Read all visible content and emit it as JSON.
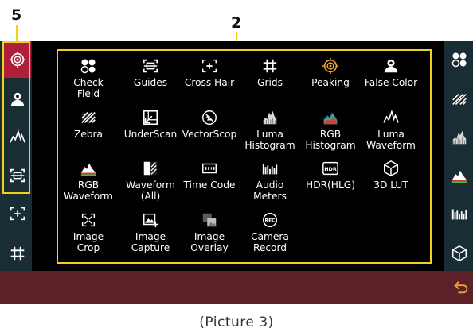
{
  "callouts": {
    "left": "5",
    "menu": "2"
  },
  "caption": "(Picture 3)",
  "colors": {
    "accent": "#f1d21a",
    "active": "#b01f3a",
    "sidebar": "#192d34",
    "bottom_bar": "#5c2128",
    "peaking": "#f0a330"
  },
  "left_sidebar": [
    {
      "name": "peaking-icon",
      "active": true
    },
    {
      "name": "false-color-icon"
    },
    {
      "name": "luma-waveform-icon"
    },
    {
      "name": "guides-icon"
    },
    {
      "name": "cross-hair-icon"
    },
    {
      "name": "grids-icon"
    }
  ],
  "right_sidebar": [
    {
      "name": "check-field-icon"
    },
    {
      "name": "zebra-icon"
    },
    {
      "name": "luma-histogram-icon"
    },
    {
      "name": "rgb-waveform-icon"
    },
    {
      "name": "audio-meters-icon"
    },
    {
      "name": "3d-lut-icon"
    }
  ],
  "back_icon": "back-arrow-icon",
  "menu": {
    "items": [
      {
        "label": "Check\nField",
        "icon": "check-field-icon"
      },
      {
        "label": "Guides",
        "icon": "guides-icon"
      },
      {
        "label": "Cross Hair",
        "icon": "cross-hair-icon"
      },
      {
        "label": "Grids",
        "icon": "grids-icon"
      },
      {
        "label": "Peaking",
        "icon": "peaking-icon"
      },
      {
        "label": "False Color",
        "icon": "false-color-icon"
      },
      {
        "label": "Zebra",
        "icon": "zebra-icon"
      },
      {
        "label": "UnderScan",
        "icon": "underscan-icon"
      },
      {
        "label": "VectorScop",
        "icon": "vectorscope-icon"
      },
      {
        "label": "Luma\nHistogram",
        "icon": "luma-histogram-icon"
      },
      {
        "label": "RGB\nHistogram",
        "icon": "rgb-histogram-icon"
      },
      {
        "label": "Luma\nWaveform",
        "icon": "luma-waveform-icon"
      },
      {
        "label": "RGB\nWaveform",
        "icon": "rgb-waveform-icon"
      },
      {
        "label": "Waveform\n(All)",
        "icon": "waveform-all-icon"
      },
      {
        "label": "Time Code",
        "icon": "time-code-icon"
      },
      {
        "label": "Audio\nMeters",
        "icon": "audio-meters-icon"
      },
      {
        "label": "HDR(HLG)",
        "icon": "hdr-icon"
      },
      {
        "label": "3D LUT",
        "icon": "3d-lut-icon"
      },
      {
        "label": "Image\nCrop",
        "icon": "image-crop-icon"
      },
      {
        "label": "Image\nCapture",
        "icon": "image-capture-icon"
      },
      {
        "label": "Image\nOverlay",
        "icon": "image-overlay-icon"
      },
      {
        "label": "Camera\nRecord",
        "icon": "camera-record-icon"
      }
    ]
  }
}
